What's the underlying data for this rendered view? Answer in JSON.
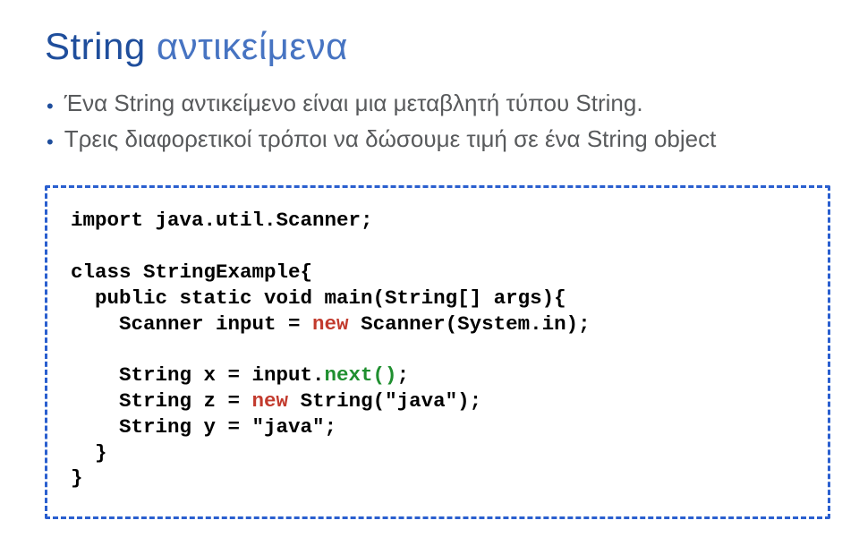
{
  "title": {
    "code_word": "String",
    "rest": "  αντικείμενα"
  },
  "bullets": [
    {
      "dot": "•",
      "text": "Ένα String αντικείμενο είναι μια μεταβλητή τύπου String."
    },
    {
      "dot": "•",
      "text": "Τρεις διαφορετικοί τρόποι να δώσουμε τιμή σε ένα String object"
    }
  ],
  "code": {
    "l01": "import java.util.Scanner;",
    "l02": "",
    "l03": "class StringExample{",
    "l04": "  public static void main(String[] args){",
    "l05_pre": "    Scanner input = ",
    "l05_kw": "new",
    "l05_post": " Scanner(System.in);",
    "l06": "",
    "l07_pre": "    String x = input.",
    "l07_call": "next()",
    "l07_post": ";",
    "l08_pre": "    String z = ",
    "l08_kw": "new",
    "l08_post": " String(\"java\");",
    "l09": "    String y = \"java\";",
    "l10": "  }",
    "l11": "}"
  }
}
